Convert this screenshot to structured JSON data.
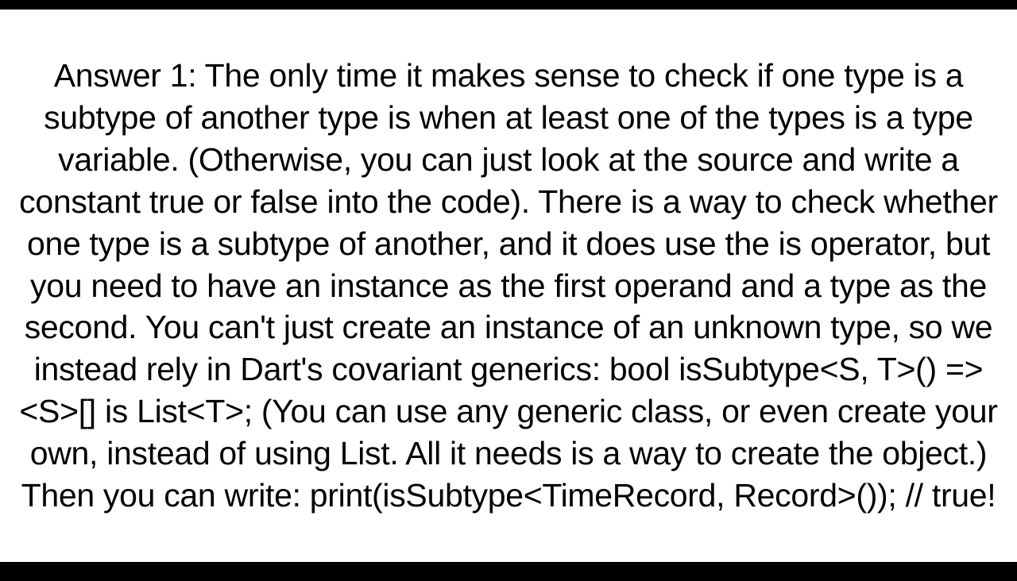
{
  "document": {
    "answer_text": "Answer 1: The only time it makes sense to check if one type is a subtype of another type is when at least one of the types is a type variable. (Otherwise, you can just look at the source and write a constant true or false into the code). There is a way to check whether one type is a subtype of another, and it does use the is operator, but you need to have an instance as the first operand and a type as the second. You can't just create an instance of an unknown type, so we instead rely in Dart's covariant generics: bool isSubtype<S, T>() => <S>[] is List<T>;  (You can use any generic class, or even create your own, instead of using List. All it needs is a way to create the object.) Then you can write:  print(isSubtype<TimeRecord, Record>()); // true!"
  }
}
